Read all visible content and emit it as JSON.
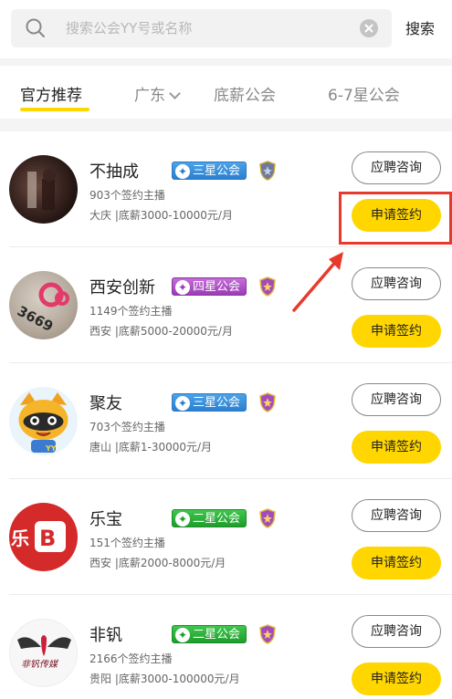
{
  "search": {
    "placeholder": "搜索公会YY号或名称",
    "button_label": "搜索"
  },
  "tabs": [
    {
      "label": "官方推荐",
      "active": true
    },
    {
      "label": "广东",
      "has_dropdown": true
    },
    {
      "label": "底薪公会"
    },
    {
      "label": "6-7星公会"
    }
  ],
  "guilds": [
    {
      "name": "不抽成",
      "badge": "三星公会",
      "badge_color": "#2b7fd0",
      "signed": "903个签约主播",
      "location_salary": "大庆 |底薪3000-10000元/月",
      "consult_label": "应聘咨询",
      "apply_label": "申请签约"
    },
    {
      "name": "西安创新",
      "badge": "四星公会",
      "badge_color": "#9a3cb6",
      "avatar_text": "3669",
      "signed": "1149个签约主播",
      "location_salary": "西安 |底薪5000-20000元/月",
      "consult_label": "应聘咨询",
      "apply_label": "申请签约"
    },
    {
      "name": "聚友",
      "badge": "三星公会",
      "badge_color": "#2b7fd0",
      "avatar_text": "YY",
      "signed": "703个签约主播",
      "location_salary": "唐山 |底薪1-30000元/月",
      "consult_label": "应聘咨询",
      "apply_label": "申请签约"
    },
    {
      "name": "乐宝",
      "badge": "二星公会",
      "badge_color": "#1e9d2c",
      "avatar_text": "乐",
      "signed": "151个签约主播",
      "location_salary": "西安 |底薪2000-8000元/月",
      "consult_label": "应聘咨询",
      "apply_label": "申请签约"
    },
    {
      "name": "非钒",
      "badge": "二星公会",
      "badge_color": "#1e9d2c",
      "avatar_text": "非钒传媒",
      "signed": "2166个签约主播",
      "location_salary": "贵阳 |底薪3000-100000元/月",
      "consult_label": "应聘咨询",
      "apply_label": "申请签约"
    }
  ],
  "colors": {
    "accent": "#ffd600",
    "annotation": "#e83a2c"
  }
}
